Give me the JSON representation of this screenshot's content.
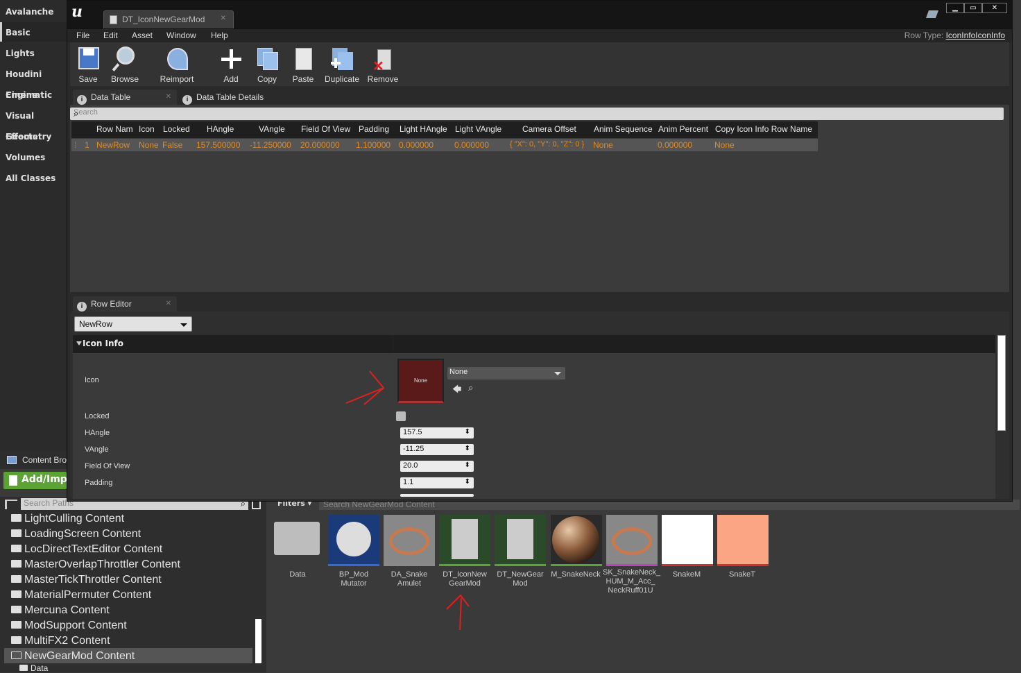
{
  "modes": [
    "Avalanche",
    "Basic",
    "Lights",
    "Houdini Engine",
    "Cinematic",
    "Visual Effects",
    "Geometry",
    "Volumes",
    "All Classes"
  ],
  "window": {
    "doc_tab": "DT_IconNewGearMod",
    "menus": [
      "File",
      "Edit",
      "Asset",
      "Window",
      "Help"
    ],
    "row_type_label": "Row Type:",
    "row_type_value": "IconInfoIconInfo"
  },
  "toolbar": [
    "Save",
    "Browse",
    "Reimport",
    "Add",
    "Copy",
    "Paste",
    "Duplicate",
    "Remove"
  ],
  "tabs": {
    "data_table": "Data Table",
    "details": "Data Table Details",
    "row_editor": "Row Editor"
  },
  "search_placeholder": "Search",
  "table": {
    "headers": [
      "Row Nam",
      "Icon",
      "Locked",
      "HAngle",
      "VAngle",
      "Field Of View",
      "Padding",
      "Light HAngle",
      "Light VAngle",
      "Camera Offset",
      "Anim Sequence",
      "Anim Percent",
      "Copy Icon Info Row Name"
    ],
    "rows": [
      {
        "index": "1",
        "cells": [
          "NewRow",
          "None",
          "False",
          "157.500000",
          "-11.250000",
          "20.000000",
          "1.100000",
          "0.000000",
          "0.000000",
          "{ \"X\": 0, \"Y\": 0, \"Z\": 0 }",
          "None",
          "0.000000",
          "None"
        ]
      }
    ]
  },
  "row_editor": {
    "selected_row": "NewRow",
    "category": "Icon Info",
    "icon_label": "Icon",
    "thumb_text": "None",
    "asset_value": "None",
    "props": [
      {
        "label": "Locked"
      },
      {
        "label": "HAngle",
        "value": "157.5"
      },
      {
        "label": "VAngle",
        "value": "-11.25"
      },
      {
        "label": "Field Of View",
        "value": "20.0"
      },
      {
        "label": "Padding",
        "value": "1.1"
      }
    ]
  },
  "content_browser": {
    "tab": "Content Browser",
    "add_import": "Add/Import",
    "path_search_placeholder": "Search Paths",
    "filters": "Filters",
    "asset_search_placeholder": "Search NewGearMod Content",
    "folders": [
      "LightCulling Content",
      "LoadingScreen Content",
      "LocDirectTextEditor Content",
      "MasterOverlapThrottler Content",
      "MasterTickThrottler Content",
      "MaterialPermuter Content",
      "Mercuna Content",
      "ModSupport Content",
      "MultiFX2 Content",
      "NewGearMod Content",
      "Data"
    ],
    "assets": [
      "Data",
      "BP_Mod Mutator",
      "DA_Snake Amulet",
      "DT_IconNew GearMod",
      "DT_NewGear Mod",
      "M_SnakeNeck",
      "SK_SnakeNeck_ HUM_M_Acc_ NeckRuff01U",
      "SnakeM",
      "SnakeT"
    ]
  },
  "colors": {
    "accent_orange": "#e08a24",
    "add_import_green": "#5aa334",
    "annotation_red": "#e02020"
  }
}
